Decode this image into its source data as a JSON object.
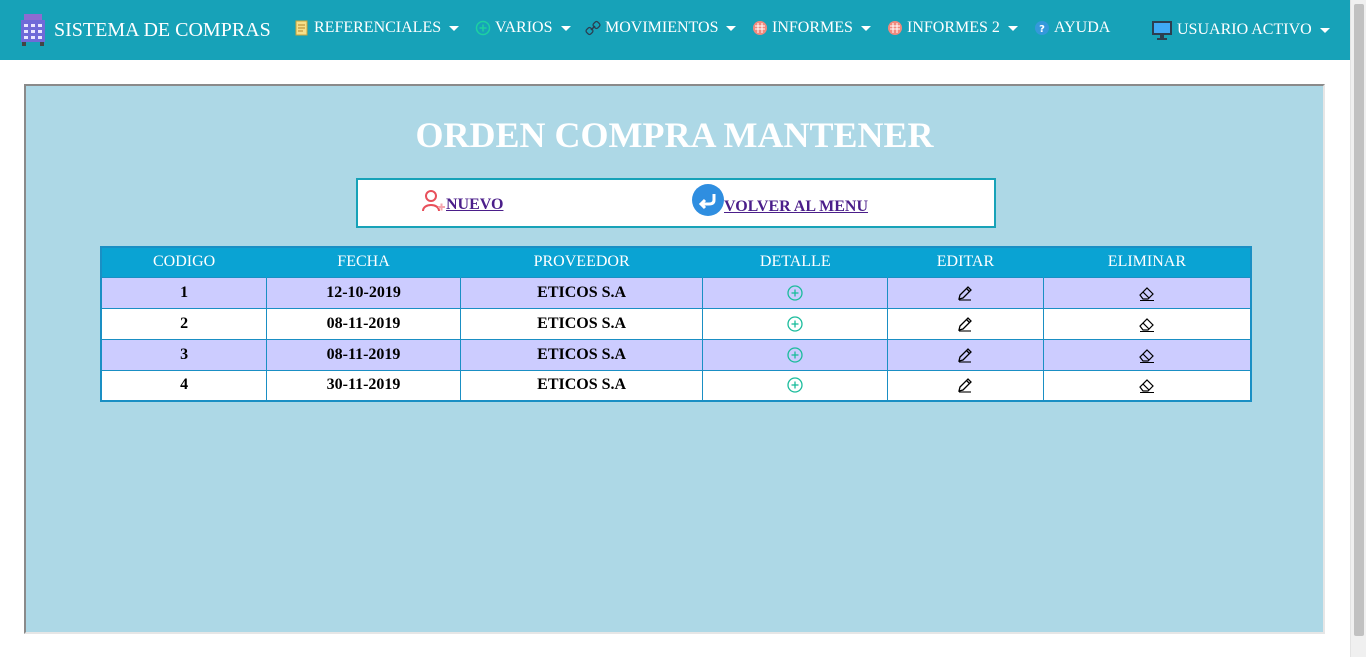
{
  "navbar": {
    "brand": "SISTEMA DE COMPRAS",
    "menus": [
      {
        "label": "REFERENCIALES",
        "icon": "notes-icon"
      },
      {
        "label": "VARIOS",
        "icon": "plus-circle-icon"
      },
      {
        "label": "MOVIMIENTOS",
        "icon": "link-icon"
      },
      {
        "label": "INFORMES",
        "icon": "report-icon"
      },
      {
        "label": "INFORMES 2",
        "icon": "report-icon"
      },
      {
        "label": "AYUDA",
        "icon": "help-icon"
      },
      {
        "label": "USUARIO ACTIVO",
        "icon": "monitor-icon"
      }
    ]
  },
  "page": {
    "title": "ORDEN COMPRA MANTENER",
    "new_label": "NUEVO",
    "back_label": "VOLVER AL MENU"
  },
  "table": {
    "headers": [
      "CODIGO",
      "FECHA",
      "PROVEEDOR",
      "DETALLE",
      "EDITAR",
      "ELIMINAR"
    ],
    "rows": [
      {
        "codigo": "1",
        "fecha": "12-10-2019",
        "proveedor": "ETICOS S.A"
      },
      {
        "codigo": "2",
        "fecha": "08-11-2019",
        "proveedor": "ETICOS S.A"
      },
      {
        "codigo": "3",
        "fecha": "08-11-2019",
        "proveedor": "ETICOS S.A"
      },
      {
        "codigo": "4",
        "fecha": "30-11-2019",
        "proveedor": "ETICOS S.A"
      }
    ]
  },
  "colors": {
    "navbar": "#17a2b8",
    "panel": "#add8e6",
    "table_header": "#0aa3d3",
    "row_alt": "#ccccff"
  }
}
